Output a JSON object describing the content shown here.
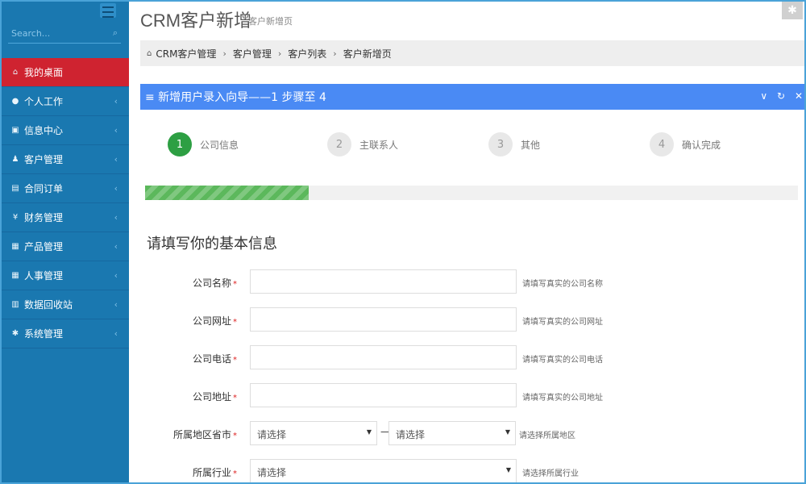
{
  "sidebar": {
    "search_placeholder": "Search...",
    "items": [
      {
        "label": "我的桌面",
        "icon": "home-icon",
        "glyph": "⌂",
        "active": true
      },
      {
        "label": "个人工作",
        "icon": "user-icon",
        "glyph": "●"
      },
      {
        "label": "信息中心",
        "icon": "inbox-icon",
        "glyph": "▣"
      },
      {
        "label": "客户管理",
        "icon": "person-icon",
        "glyph": "♟"
      },
      {
        "label": "合同订单",
        "icon": "book-icon",
        "glyph": "▤"
      },
      {
        "label": "财务管理",
        "icon": "yen-icon",
        "glyph": "¥"
      },
      {
        "label": "产品管理",
        "icon": "grid-icon",
        "glyph": "▦"
      },
      {
        "label": "人事管理",
        "icon": "table-icon",
        "glyph": "▦"
      },
      {
        "label": "数据回收站",
        "icon": "trash-icon",
        "glyph": "▥"
      },
      {
        "label": "系统管理",
        "icon": "gear-icon",
        "glyph": "✱"
      }
    ]
  },
  "header": {
    "title": "CRM客户新增",
    "subtitle": "客户新增页"
  },
  "breadcrumb": [
    "CRM客户管理",
    "客户管理",
    "客户列表",
    "客户新增页"
  ],
  "wizard": {
    "title": "≡ 新增用户录入向导——1 步骤至 4",
    "steps": [
      {
        "num": "1",
        "label": "公司信息",
        "done": true
      },
      {
        "num": "2",
        "label": "主联系人"
      },
      {
        "num": "3",
        "label": "其他"
      },
      {
        "num": "4",
        "label": "确认完成"
      }
    ],
    "progress_percent": 25
  },
  "form": {
    "section_title": "请填写你的基本信息",
    "fields": {
      "company_name": {
        "label": "公司名称",
        "hint": "请填写真实的公司名称"
      },
      "company_url": {
        "label": "公司网址",
        "hint": "请填写真实的公司网址"
      },
      "company_phone": {
        "label": "公司电话",
        "hint": "请填写真实的公司电话"
      },
      "company_address": {
        "label": "公司地址",
        "hint": "请填写真实的公司地址"
      },
      "region": {
        "label": "所属地区省市",
        "province": "请选择",
        "city": "请选择",
        "separator": "—",
        "hint": "请选择所属地区"
      },
      "industry": {
        "label": "所属行业",
        "value": "请选择",
        "hint": "请选择所属行业"
      }
    }
  },
  "colors": {
    "sidebar": "#1a78b0",
    "active_item": "#cf2330",
    "wizard_header": "#4a8af4",
    "step_done": "#2d9f43",
    "progress": "#5cb85c"
  }
}
